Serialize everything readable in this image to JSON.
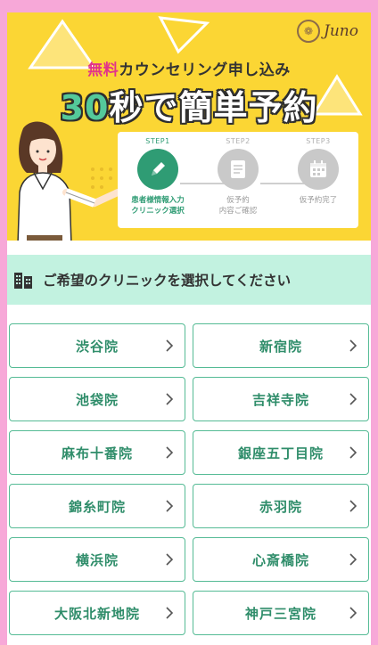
{
  "brand": {
    "logo_text": "Juno",
    "logo_mark": "❁"
  },
  "banner": {
    "free_label": "無料",
    "subtitle_rest": "カウンセリング申し込み",
    "headline_accent": "30",
    "headline_rest": "秒で簡単予約"
  },
  "steps": [
    {
      "num": "STEP1",
      "text": "患者様情報入力\nクリニック選択",
      "icon": "pencil-icon",
      "active": true
    },
    {
      "num": "STEP2",
      "text": "仮予約\n内容ご確認",
      "icon": "document-icon",
      "active": false
    },
    {
      "num": "STEP3",
      "text": "仮予約完了",
      "icon": "calendar-icon",
      "active": false
    }
  ],
  "section": {
    "title": "ご希望のクリニックを選択してください",
    "icon": "building-icon"
  },
  "clinics": [
    "渋谷院",
    "新宿院",
    "池袋院",
    "吉祥寺院",
    "麻布十番院",
    "銀座五丁目院",
    "錦糸町院",
    "赤羽院",
    "横浜院",
    "心斎橋院",
    "大阪北新地院",
    "神戸三宮院"
  ],
  "colors": {
    "outer_background": "#f7a8d8",
    "banner_yellow": "#fbd634",
    "accent_green": "#2f9c74",
    "section_mint": "#c2f2e0",
    "free_pink": "#e2338a"
  }
}
